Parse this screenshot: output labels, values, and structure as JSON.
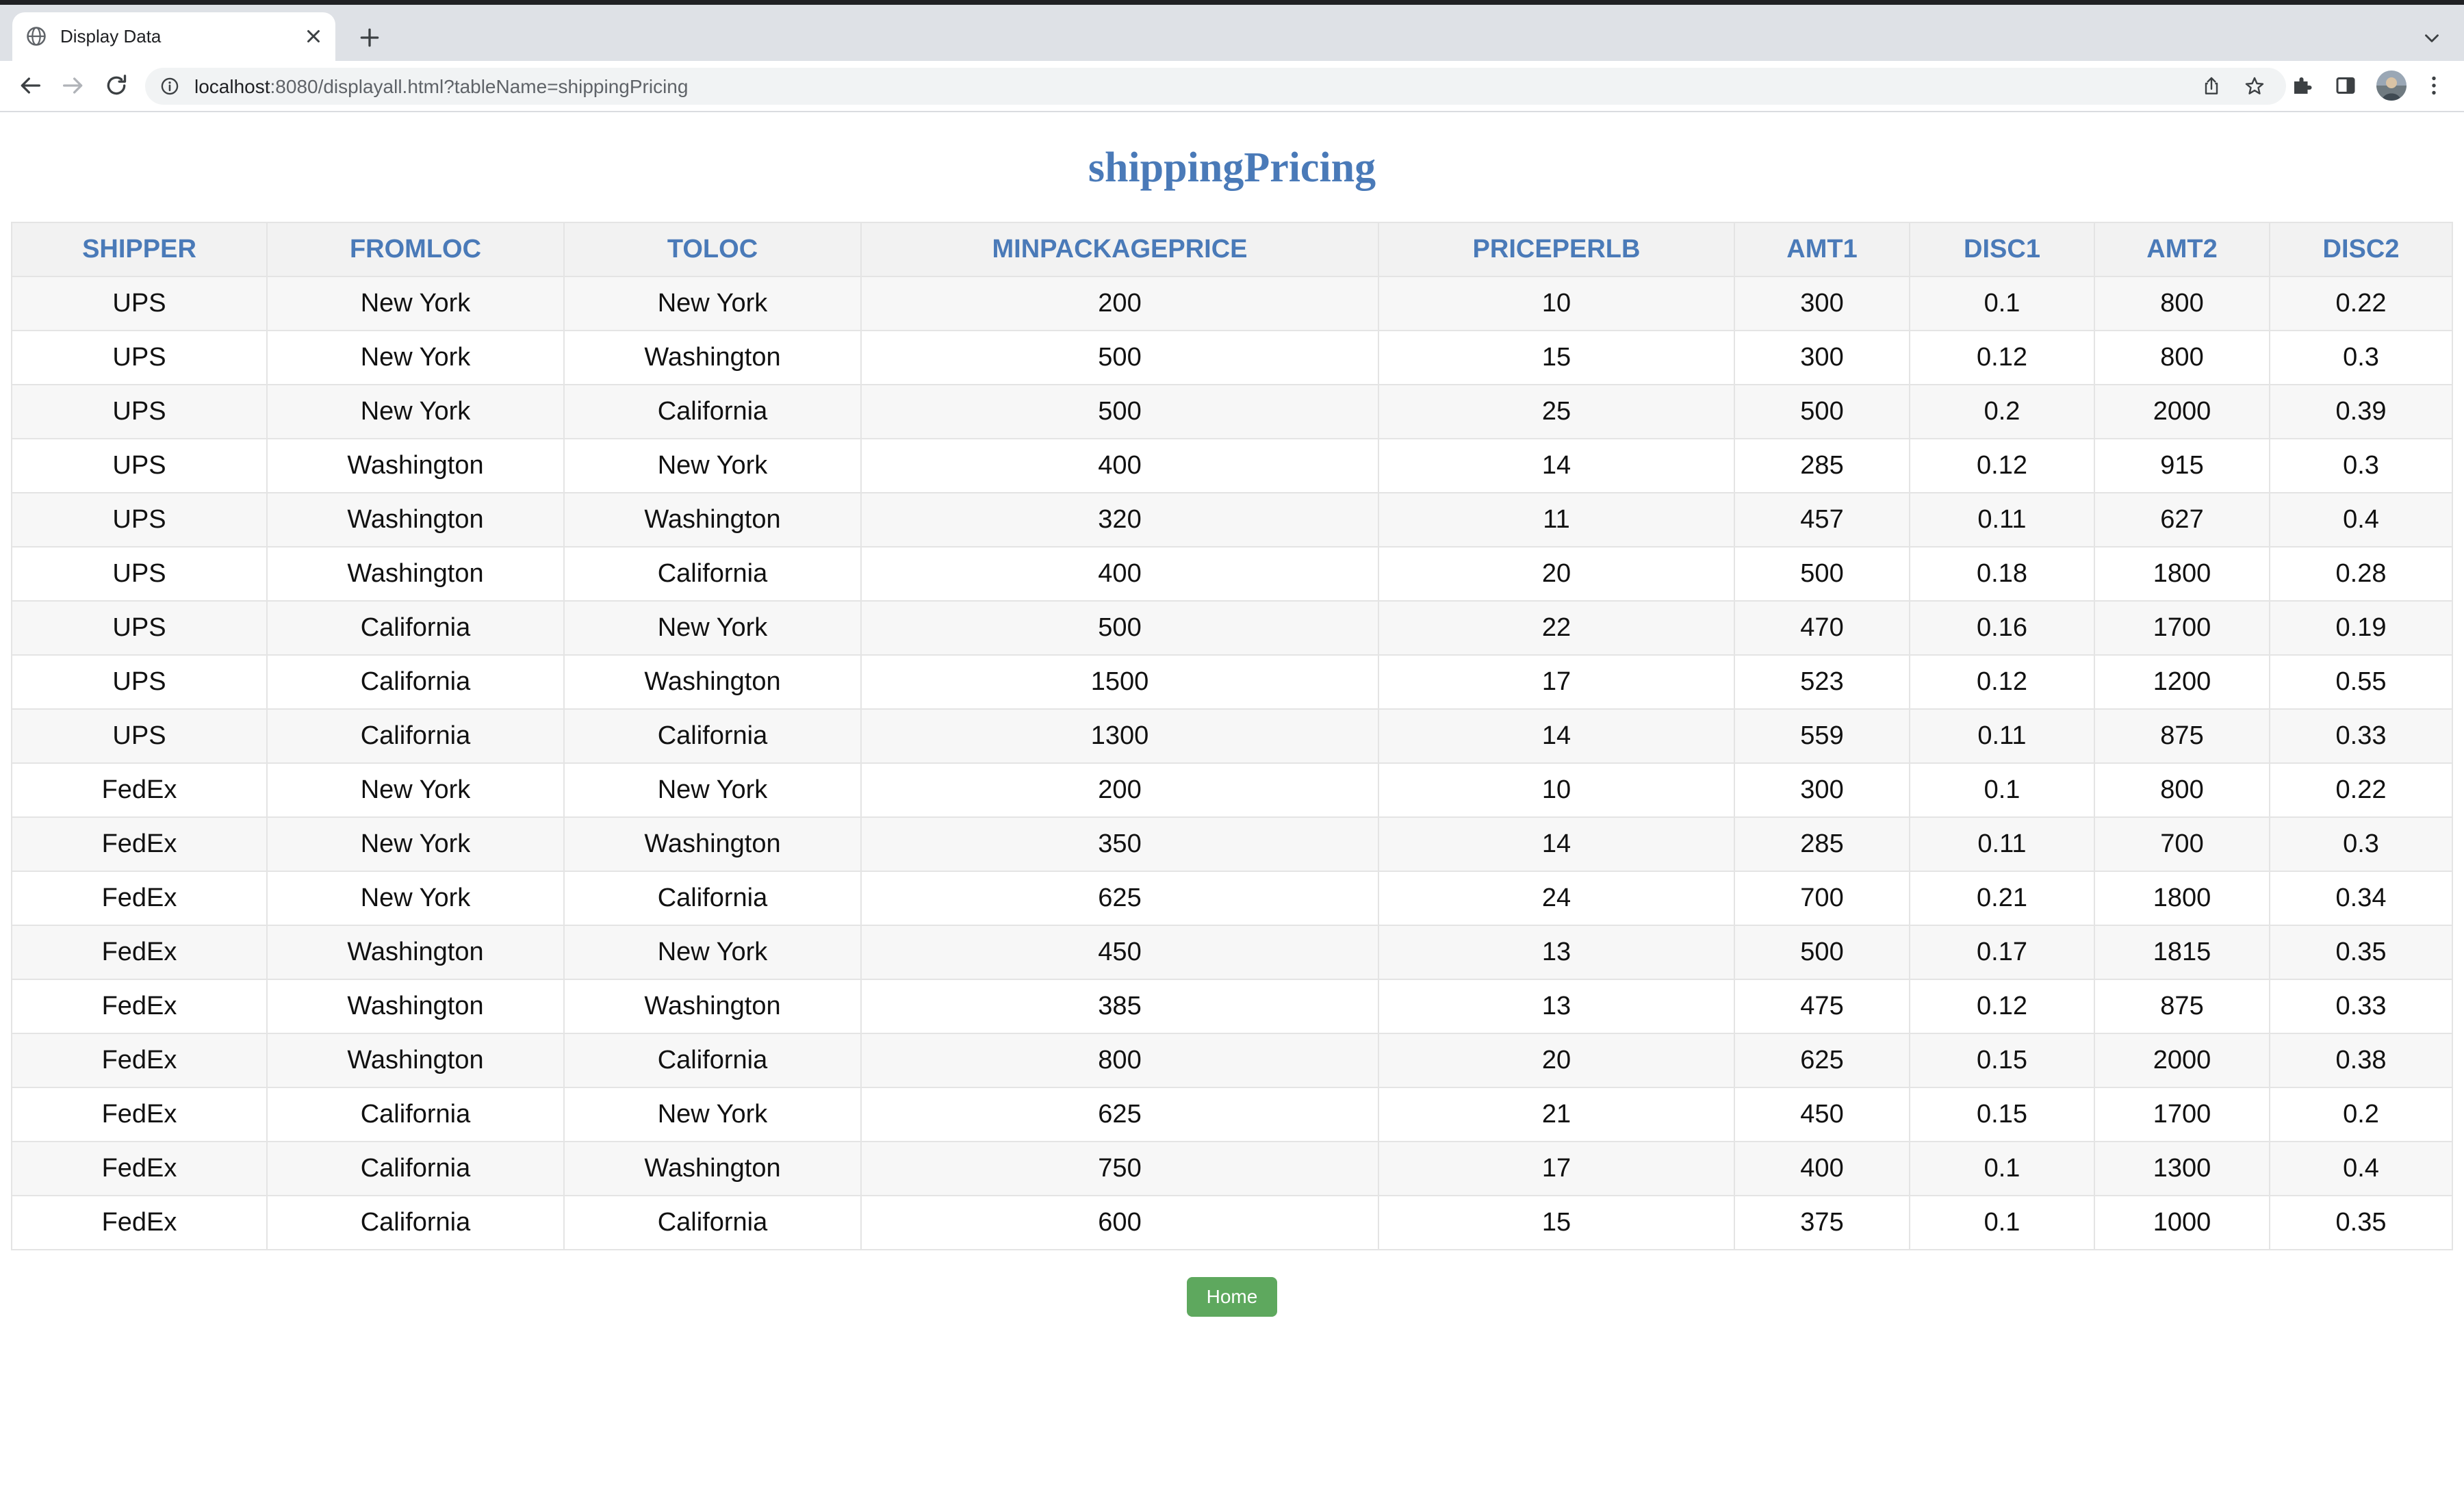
{
  "browser": {
    "tab_title": "Display Data",
    "url_host": "localhost",
    "url_rest": ":8080/displayall.html?tableName=shippingPricing"
  },
  "page": {
    "title": "shippingPricing",
    "home_button": "Home"
  },
  "table": {
    "columns": [
      "SHIPPER",
      "FROMLOC",
      "TOLOC",
      "MINPACKAGEPRICE",
      "PRICEPERLB",
      "AMT1",
      "DISC1",
      "AMT2",
      "DISC2"
    ],
    "rows": [
      [
        "UPS",
        "New York",
        "New York",
        "200",
        "10",
        "300",
        "0.1",
        "800",
        "0.22"
      ],
      [
        "UPS",
        "New York",
        "Washington",
        "500",
        "15",
        "300",
        "0.12",
        "800",
        "0.3"
      ],
      [
        "UPS",
        "New York",
        "California",
        "500",
        "25",
        "500",
        "0.2",
        "2000",
        "0.39"
      ],
      [
        "UPS",
        "Washington",
        "New York",
        "400",
        "14",
        "285",
        "0.12",
        "915",
        "0.3"
      ],
      [
        "UPS",
        "Washington",
        "Washington",
        "320",
        "11",
        "457",
        "0.11",
        "627",
        "0.4"
      ],
      [
        "UPS",
        "Washington",
        "California",
        "400",
        "20",
        "500",
        "0.18",
        "1800",
        "0.28"
      ],
      [
        "UPS",
        "California",
        "New York",
        "500",
        "22",
        "470",
        "0.16",
        "1700",
        "0.19"
      ],
      [
        "UPS",
        "California",
        "Washington",
        "1500",
        "17",
        "523",
        "0.12",
        "1200",
        "0.55"
      ],
      [
        "UPS",
        "California",
        "California",
        "1300",
        "14",
        "559",
        "0.11",
        "875",
        "0.33"
      ],
      [
        "FedEx",
        "New York",
        "New York",
        "200",
        "10",
        "300",
        "0.1",
        "800",
        "0.22"
      ],
      [
        "FedEx",
        "New York",
        "Washington",
        "350",
        "14",
        "285",
        "0.11",
        "700",
        "0.3"
      ],
      [
        "FedEx",
        "New York",
        "California",
        "625",
        "24",
        "700",
        "0.21",
        "1800",
        "0.34"
      ],
      [
        "FedEx",
        "Washington",
        "New York",
        "450",
        "13",
        "500",
        "0.17",
        "1815",
        "0.35"
      ],
      [
        "FedEx",
        "Washington",
        "Washington",
        "385",
        "13",
        "475",
        "0.12",
        "875",
        "0.33"
      ],
      [
        "FedEx",
        "Washington",
        "California",
        "800",
        "20",
        "625",
        "0.15",
        "2000",
        "0.38"
      ],
      [
        "FedEx",
        "California",
        "New York",
        "625",
        "21",
        "450",
        "0.15",
        "1700",
        "0.2"
      ],
      [
        "FedEx",
        "California",
        "Washington",
        "750",
        "17",
        "400",
        "0.1",
        "1300",
        "0.4"
      ],
      [
        "FedEx",
        "California",
        "California",
        "600",
        "15",
        "375",
        "0.1",
        "1000",
        "0.35"
      ]
    ]
  }
}
